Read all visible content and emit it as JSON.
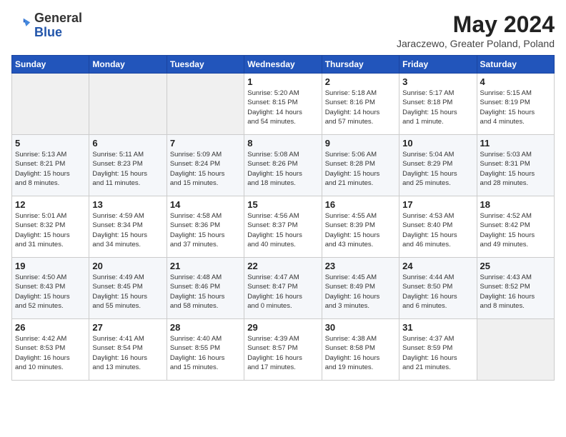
{
  "header": {
    "logo_general": "General",
    "logo_blue": "Blue",
    "month": "May 2024",
    "location": "Jaraczewo, Greater Poland, Poland"
  },
  "days_of_week": [
    "Sunday",
    "Monday",
    "Tuesday",
    "Wednesday",
    "Thursday",
    "Friday",
    "Saturday"
  ],
  "weeks": [
    [
      {
        "day": "",
        "info": ""
      },
      {
        "day": "",
        "info": ""
      },
      {
        "day": "",
        "info": ""
      },
      {
        "day": "1",
        "info": "Sunrise: 5:20 AM\nSunset: 8:15 PM\nDaylight: 14 hours\nand 54 minutes."
      },
      {
        "day": "2",
        "info": "Sunrise: 5:18 AM\nSunset: 8:16 PM\nDaylight: 14 hours\nand 57 minutes."
      },
      {
        "day": "3",
        "info": "Sunrise: 5:17 AM\nSunset: 8:18 PM\nDaylight: 15 hours\nand 1 minute."
      },
      {
        "day": "4",
        "info": "Sunrise: 5:15 AM\nSunset: 8:19 PM\nDaylight: 15 hours\nand 4 minutes."
      }
    ],
    [
      {
        "day": "5",
        "info": "Sunrise: 5:13 AM\nSunset: 8:21 PM\nDaylight: 15 hours\nand 8 minutes."
      },
      {
        "day": "6",
        "info": "Sunrise: 5:11 AM\nSunset: 8:23 PM\nDaylight: 15 hours\nand 11 minutes."
      },
      {
        "day": "7",
        "info": "Sunrise: 5:09 AM\nSunset: 8:24 PM\nDaylight: 15 hours\nand 15 minutes."
      },
      {
        "day": "8",
        "info": "Sunrise: 5:08 AM\nSunset: 8:26 PM\nDaylight: 15 hours\nand 18 minutes."
      },
      {
        "day": "9",
        "info": "Sunrise: 5:06 AM\nSunset: 8:28 PM\nDaylight: 15 hours\nand 21 minutes."
      },
      {
        "day": "10",
        "info": "Sunrise: 5:04 AM\nSunset: 8:29 PM\nDaylight: 15 hours\nand 25 minutes."
      },
      {
        "day": "11",
        "info": "Sunrise: 5:03 AM\nSunset: 8:31 PM\nDaylight: 15 hours\nand 28 minutes."
      }
    ],
    [
      {
        "day": "12",
        "info": "Sunrise: 5:01 AM\nSunset: 8:32 PM\nDaylight: 15 hours\nand 31 minutes."
      },
      {
        "day": "13",
        "info": "Sunrise: 4:59 AM\nSunset: 8:34 PM\nDaylight: 15 hours\nand 34 minutes."
      },
      {
        "day": "14",
        "info": "Sunrise: 4:58 AM\nSunset: 8:36 PM\nDaylight: 15 hours\nand 37 minutes."
      },
      {
        "day": "15",
        "info": "Sunrise: 4:56 AM\nSunset: 8:37 PM\nDaylight: 15 hours\nand 40 minutes."
      },
      {
        "day": "16",
        "info": "Sunrise: 4:55 AM\nSunset: 8:39 PM\nDaylight: 15 hours\nand 43 minutes."
      },
      {
        "day": "17",
        "info": "Sunrise: 4:53 AM\nSunset: 8:40 PM\nDaylight: 15 hours\nand 46 minutes."
      },
      {
        "day": "18",
        "info": "Sunrise: 4:52 AM\nSunset: 8:42 PM\nDaylight: 15 hours\nand 49 minutes."
      }
    ],
    [
      {
        "day": "19",
        "info": "Sunrise: 4:50 AM\nSunset: 8:43 PM\nDaylight: 15 hours\nand 52 minutes."
      },
      {
        "day": "20",
        "info": "Sunrise: 4:49 AM\nSunset: 8:45 PM\nDaylight: 15 hours\nand 55 minutes."
      },
      {
        "day": "21",
        "info": "Sunrise: 4:48 AM\nSunset: 8:46 PM\nDaylight: 15 hours\nand 58 minutes."
      },
      {
        "day": "22",
        "info": "Sunrise: 4:47 AM\nSunset: 8:47 PM\nDaylight: 16 hours\nand 0 minutes."
      },
      {
        "day": "23",
        "info": "Sunrise: 4:45 AM\nSunset: 8:49 PM\nDaylight: 16 hours\nand 3 minutes."
      },
      {
        "day": "24",
        "info": "Sunrise: 4:44 AM\nSunset: 8:50 PM\nDaylight: 16 hours\nand 6 minutes."
      },
      {
        "day": "25",
        "info": "Sunrise: 4:43 AM\nSunset: 8:52 PM\nDaylight: 16 hours\nand 8 minutes."
      }
    ],
    [
      {
        "day": "26",
        "info": "Sunrise: 4:42 AM\nSunset: 8:53 PM\nDaylight: 16 hours\nand 10 minutes."
      },
      {
        "day": "27",
        "info": "Sunrise: 4:41 AM\nSunset: 8:54 PM\nDaylight: 16 hours\nand 13 minutes."
      },
      {
        "day": "28",
        "info": "Sunrise: 4:40 AM\nSunset: 8:55 PM\nDaylight: 16 hours\nand 15 minutes."
      },
      {
        "day": "29",
        "info": "Sunrise: 4:39 AM\nSunset: 8:57 PM\nDaylight: 16 hours\nand 17 minutes."
      },
      {
        "day": "30",
        "info": "Sunrise: 4:38 AM\nSunset: 8:58 PM\nDaylight: 16 hours\nand 19 minutes."
      },
      {
        "day": "31",
        "info": "Sunrise: 4:37 AM\nSunset: 8:59 PM\nDaylight: 16 hours\nand 21 minutes."
      },
      {
        "day": "",
        "info": ""
      }
    ]
  ]
}
